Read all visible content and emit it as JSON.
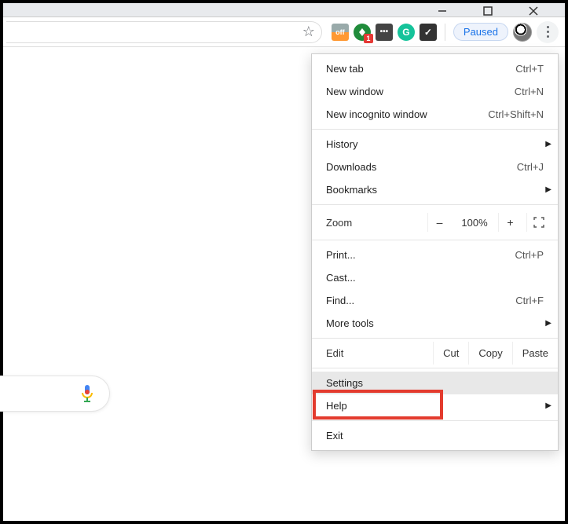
{
  "window_controls": {
    "minimize": "–",
    "maximize": "◻",
    "close": "✕"
  },
  "toolbar": {
    "star_tooltip": "Bookmark",
    "extensions": {
      "off": "off",
      "avast_badge": "1",
      "pw": "•••",
      "grammarly": "G",
      "task": "✓"
    },
    "paused": "Paused"
  },
  "menu": {
    "new_tab": {
      "label": "New tab",
      "shortcut": "Ctrl+T"
    },
    "new_window": {
      "label": "New window",
      "shortcut": "Ctrl+N"
    },
    "new_incognito": {
      "label": "New incognito window",
      "shortcut": "Ctrl+Shift+N"
    },
    "history": {
      "label": "History"
    },
    "downloads": {
      "label": "Downloads",
      "shortcut": "Ctrl+J"
    },
    "bookmarks": {
      "label": "Bookmarks"
    },
    "zoom": {
      "label": "Zoom",
      "minus": "–",
      "value": "100%",
      "plus": "+"
    },
    "print": {
      "label": "Print...",
      "shortcut": "Ctrl+P"
    },
    "cast": {
      "label": "Cast..."
    },
    "find": {
      "label": "Find...",
      "shortcut": "Ctrl+F"
    },
    "more_tools": {
      "label": "More tools"
    },
    "edit": {
      "label": "Edit",
      "cut": "Cut",
      "copy": "Copy",
      "paste": "Paste"
    },
    "settings": {
      "label": "Settings"
    },
    "help": {
      "label": "Help"
    },
    "exit": {
      "label": "Exit"
    }
  }
}
